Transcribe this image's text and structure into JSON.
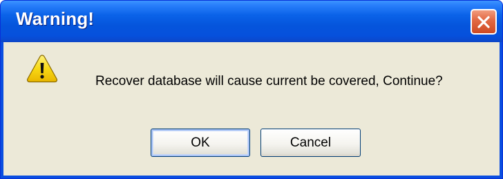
{
  "dialog": {
    "title": "Warning!",
    "message": "Recover database will cause current be covered, Continue?",
    "icon": "warning-icon"
  },
  "buttons": {
    "ok_label": "OK",
    "cancel_label": "Cancel",
    "close_icon": "close-icon"
  },
  "colors": {
    "titlebar": "#0555dc",
    "close_button": "#e36b46",
    "client_background": "#ece9d8",
    "warning_yellow": "#f5d400"
  }
}
